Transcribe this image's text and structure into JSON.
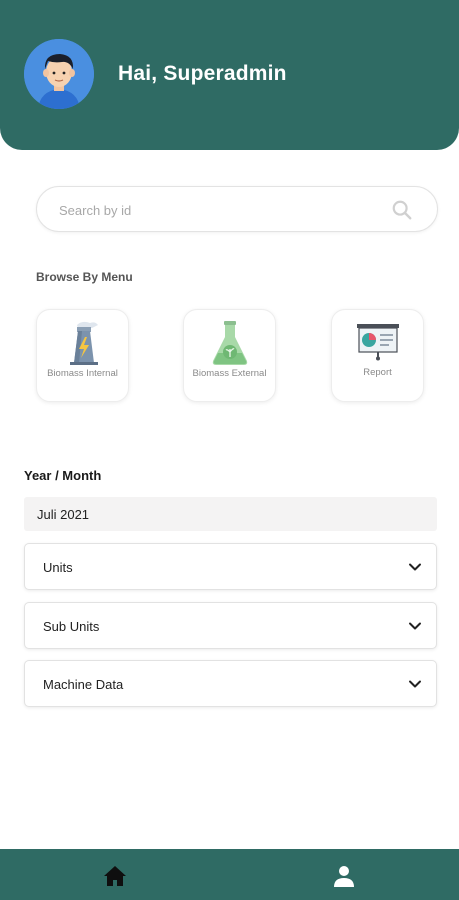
{
  "header": {
    "greeting": "Hai, Superadmin",
    "background_color": "#2f6b64"
  },
  "search": {
    "placeholder": "Search by id",
    "value": "",
    "icon": "search-icon"
  },
  "browse": {
    "title": "Browse By Menu",
    "items": [
      {
        "label": "Biomass Internal",
        "icon": "power-plant-icon"
      },
      {
        "label": "Biomass External",
        "icon": "flask-leaf-icon"
      },
      {
        "label": "Report",
        "icon": "presentation-chart-icon"
      }
    ]
  },
  "filters": {
    "period_label": "Year / Month",
    "period_value": "Juli 2021",
    "selects": [
      {
        "label": "Units"
      },
      {
        "label": "Sub Units"
      },
      {
        "label": "Machine Data"
      }
    ]
  },
  "nav": {
    "items": [
      {
        "name": "home",
        "icon": "home-icon"
      },
      {
        "name": "profile",
        "icon": "person-icon"
      }
    ]
  }
}
